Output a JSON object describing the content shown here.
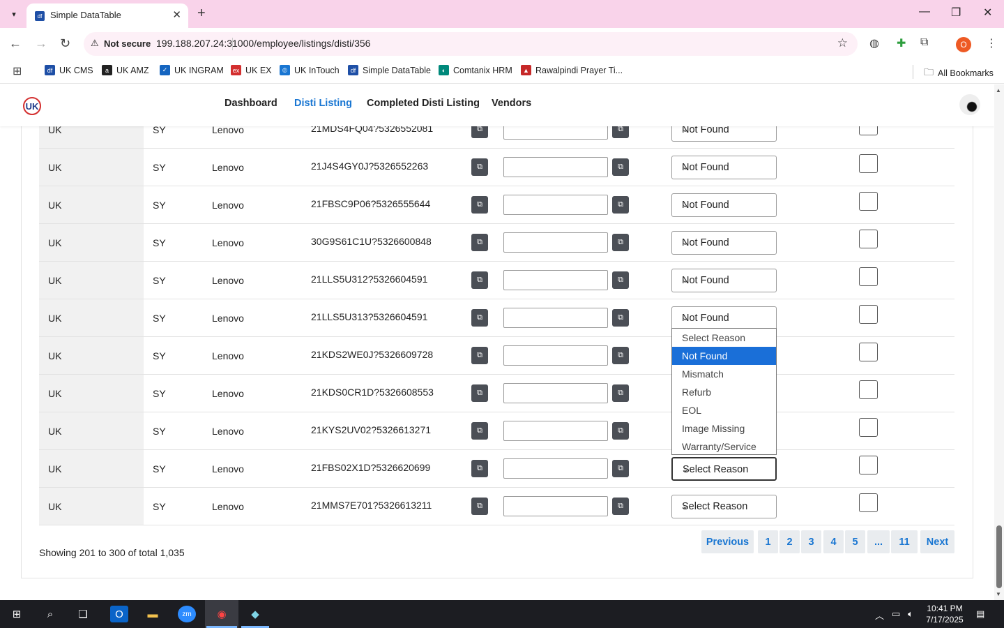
{
  "browser": {
    "tab_title": "Simple DataTable",
    "tab_favicon": "df",
    "security_label": "Not secure",
    "url": "199.188.207.24:31000/employee/listings/disti/356",
    "profile_initial": "O",
    "bookmarks": [
      {
        "label": "UK CMS",
        "icon": "df",
        "color": "#1e4fa6"
      },
      {
        "label": "UK AMZ",
        "icon": "a",
        "color": "#222222"
      },
      {
        "label": "UK INGRAM",
        "icon": "✓",
        "color": "#1565c0"
      },
      {
        "label": "UK EX",
        "icon": "ex",
        "color": "#d32f2f"
      },
      {
        "label": "UK InTouch",
        "icon": "©",
        "color": "#1976d2"
      },
      {
        "label": "Simple DataTable",
        "icon": "df",
        "color": "#1e4fa6"
      },
      {
        "label": "Comtanix HRM",
        "icon": "◐",
        "color": "#00897b"
      },
      {
        "label": "Rawalpindi Prayer Ti...",
        "icon": "▲",
        "color": "#c62828"
      }
    ],
    "all_bookmarks_label": "All Bookmarks"
  },
  "nav": {
    "items": [
      "Dashboard",
      "Disti Listing",
      "Completed Disti Listing",
      "Vendors"
    ],
    "active": "Disti Listing",
    "logo_text": "UK"
  },
  "table": {
    "rows": [
      {
        "country": "UK",
        "code": "SY",
        "brand": "Lenovo",
        "sku": "21MDS4FQ04?5326552081",
        "reason": "Not Found"
      },
      {
        "country": "UK",
        "code": "SY",
        "brand": "Lenovo",
        "sku": "21J4S4GY0J?5326552263",
        "reason": "Not Found"
      },
      {
        "country": "UK",
        "code": "SY",
        "brand": "Lenovo",
        "sku": "21FBSC9P06?5326555644",
        "reason": "Not Found"
      },
      {
        "country": "UK",
        "code": "SY",
        "brand": "Lenovo",
        "sku": "30G9S61C1U?5326600848",
        "reason": "Not Found"
      },
      {
        "country": "UK",
        "code": "SY",
        "brand": "Lenovo",
        "sku": "21LLS5U312?5326604591",
        "reason": "Not Found"
      },
      {
        "country": "UK",
        "code": "SY",
        "brand": "Lenovo",
        "sku": "21LLS5U313?5326604591",
        "reason": "Not Found"
      },
      {
        "country": "UK",
        "code": "SY",
        "brand": "Lenovo",
        "sku": "21KDS2WE0J?5326609728",
        "reason": ""
      },
      {
        "country": "UK",
        "code": "SY",
        "brand": "Lenovo",
        "sku": "21KDS0CR1D?5326608553",
        "reason": ""
      },
      {
        "country": "UK",
        "code": "SY",
        "brand": "Lenovo",
        "sku": "21KYS2UV02?5326613271",
        "reason": ""
      },
      {
        "country": "UK",
        "code": "SY",
        "brand": "Lenovo",
        "sku": "21FBS02X1D?5326620699",
        "reason": "Select Reason"
      },
      {
        "country": "UK",
        "code": "SY",
        "brand": "Lenovo",
        "sku": "21MMS7E701?5326613211",
        "reason": "Select Reason"
      }
    ]
  },
  "dropdown": {
    "options": [
      "Select Reason",
      "Not Found",
      "Mismatch",
      "Refurb",
      "EOL",
      "Image Missing",
      "Warranty/Service"
    ],
    "highlighted": "Not Found"
  },
  "footer": {
    "showing": "Showing 201 to 300 of total 1,035",
    "pagination": [
      "Previous",
      "1",
      "2",
      "3",
      "4",
      "5",
      "...",
      "11",
      "Next"
    ]
  },
  "taskbar": {
    "time": "10:41 PM",
    "date": "7/17/2025"
  }
}
